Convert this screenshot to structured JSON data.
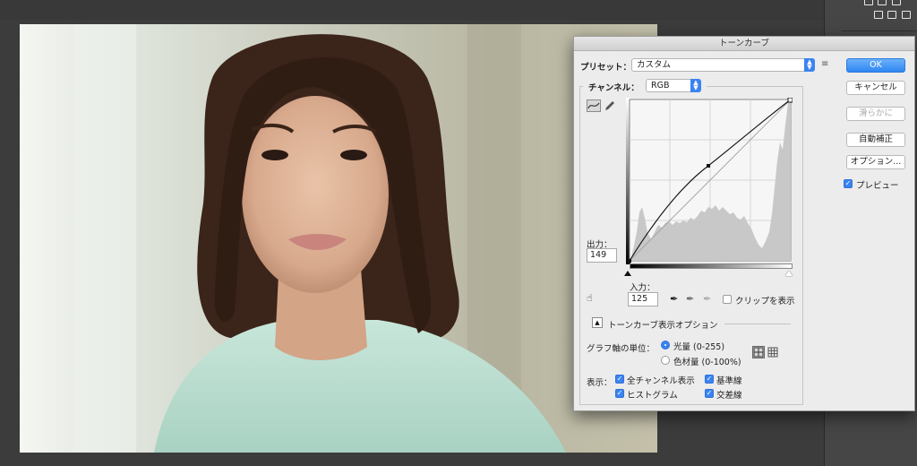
{
  "dialog": {
    "title": "トーンカーブ",
    "preset_label": "プリセット：",
    "preset_value": "カスタム",
    "channel_label": "チャンネル：",
    "channel_value": "RGB",
    "output_label": "出力：",
    "output_value": "149",
    "input_label": "入力：",
    "input_value": "125",
    "show_clipping_label": "クリップを表示",
    "display_options_label": "トーンカーブ表示オプション",
    "graph_unit_label": "グラフ軸の単位：",
    "unit_light_label": "光量 (0-255)",
    "unit_pigment_label": "色材量 (0-100%)",
    "show_label": "表示：",
    "show_channel_overlays_label": "全チャンネル表示",
    "show_baseline_label": "基準線",
    "show_histogram_label": "ヒストグラム",
    "show_intersection_label": "交差線"
  },
  "buttons": {
    "ok": "OK",
    "cancel": "キャンセル",
    "smooth": "滑らかに",
    "auto": "自動補正",
    "options": "オプション..."
  },
  "preview": {
    "label": "プレビュー",
    "checked": true
  },
  "states": {
    "unit_light_selected": true,
    "show_clipping": false,
    "channel_overlays": true,
    "baseline": true,
    "histogram": true,
    "intersection": true
  },
  "curve": {
    "control_points": [
      [
        0,
        0
      ],
      [
        125,
        149
      ],
      [
        255,
        255
      ]
    ]
  },
  "colors": {
    "accent": "#3b83f2",
    "dialog_bg": "#ececec"
  }
}
